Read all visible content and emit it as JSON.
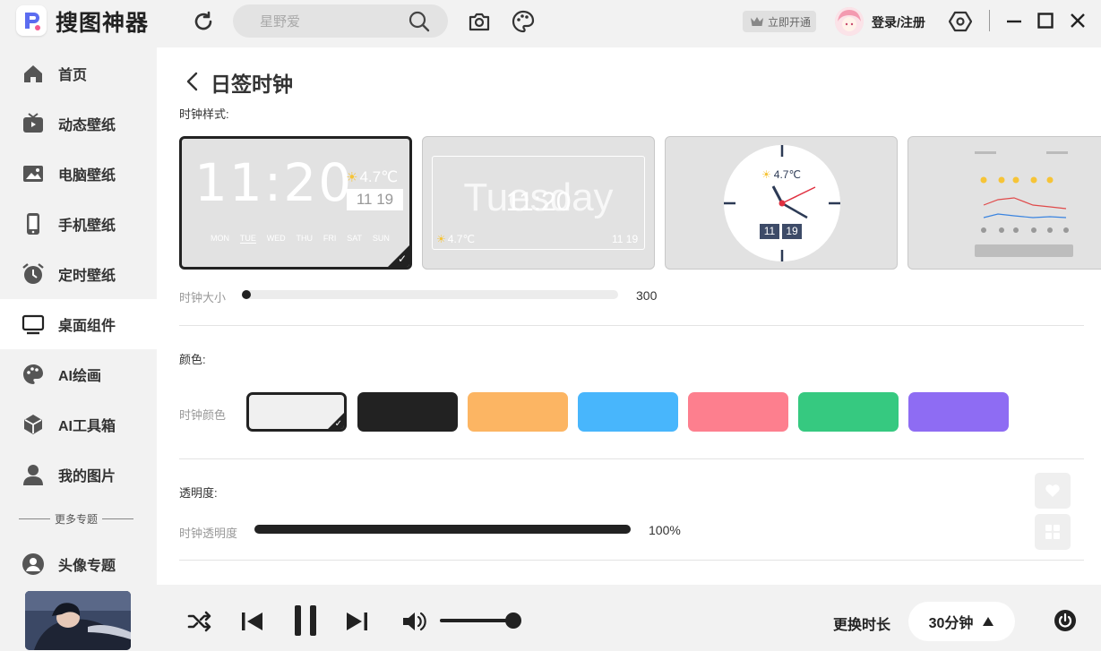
{
  "app": {
    "name": "搜图神器"
  },
  "header": {
    "search_placeholder": "星野爱",
    "vip_label": "立即开通",
    "login_label": "登录/注册"
  },
  "sidebar": {
    "items": [
      {
        "label": "首页",
        "icon": "home-icon"
      },
      {
        "label": "动态壁纸",
        "icon": "tv-icon"
      },
      {
        "label": "电脑壁纸",
        "icon": "image-icon"
      },
      {
        "label": "手机壁纸",
        "icon": "phone-icon"
      },
      {
        "label": "定时壁纸",
        "icon": "alarm-clock-icon"
      },
      {
        "label": "桌面组件",
        "icon": "monitor-icon",
        "active": true
      },
      {
        "label": "AI绘画",
        "icon": "palette-icon"
      },
      {
        "label": "AI工具箱",
        "icon": "cube-icon"
      },
      {
        "label": "我的图片",
        "icon": "user-icon"
      }
    ],
    "more_topics_label": "更多专题",
    "topics": [
      {
        "label": "头像专题",
        "icon": "avatar-circle-icon"
      }
    ]
  },
  "main": {
    "title": "日签时钟",
    "clock_style_label": "时钟样式:",
    "styles": [
      {
        "time": "11:20",
        "temp": "4.7℃",
        "date": "11 19",
        "days": [
          "MON",
          "TUE",
          "WED",
          "THU",
          "FRI",
          "SAT",
          "SUN"
        ],
        "active_day": "TUE"
      },
      {
        "time": "11:20",
        "weekday": "Tuesday",
        "temp": "4.7℃",
        "date": "11 19"
      },
      {
        "temp": "4.7℃",
        "month": "11",
        "day": "19"
      },
      {
        "type": "weather-forecast"
      }
    ],
    "size_label": "时钟大小",
    "size_value": "300",
    "color_section_label": "颜色:",
    "clock_color_label": "时钟颜色",
    "colors": [
      "#f0f0f0",
      "#222222",
      "#fcb563",
      "#48b6fc",
      "#fd7f8e",
      "#36c980",
      "#8e6cf3"
    ],
    "opacity_section_label": "透明度:",
    "opacity_label": "时钟透明度",
    "opacity_value": "100%",
    "opacity_fraction": 1.0
  },
  "player": {
    "interval_label": "更换时长",
    "interval_value": "30分钟",
    "volume_fraction": 0.9
  }
}
